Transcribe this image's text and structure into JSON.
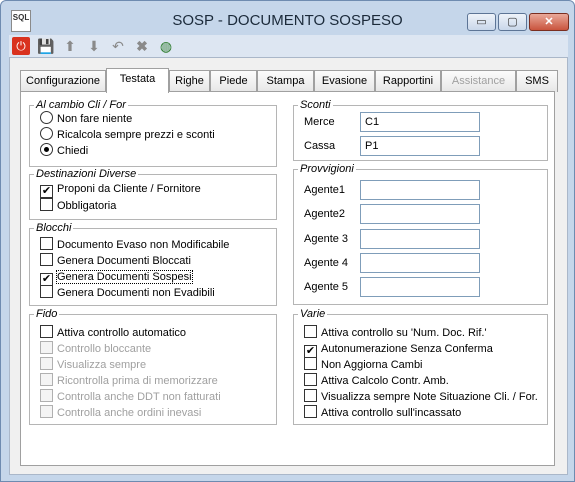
{
  "window": {
    "title": "SOSP - DOCUMENTO SOSPESO",
    "app_icon_text": "SQL",
    "minimize_symbol": "▭",
    "maximize_symbol": "▢",
    "close_symbol": "✕"
  },
  "toolbar": {
    "power_glyph": "⏻",
    "save_glyph": "💾",
    "up_glyph": "⬆",
    "down_glyph": "⬇",
    "undo_glyph": "↶",
    "delete_glyph": "✖",
    "globe_glyph": "◍"
  },
  "tabs": [
    {
      "label": "Configurazione"
    },
    {
      "label": "Testata"
    },
    {
      "label": "Righe"
    },
    {
      "label": "Piede"
    },
    {
      "label": "Stampa"
    },
    {
      "label": "Evasione"
    },
    {
      "label": "Rapportini"
    },
    {
      "label": "Assistance"
    },
    {
      "label": "SMS"
    }
  ],
  "cambio": {
    "title": "Al cambio Cli / For",
    "options": [
      "Non fare niente",
      "Ricalcola sempre prezzi e sconti",
      "Chiedi"
    ],
    "selected": "Chiedi"
  },
  "destinazioni": {
    "title": "Destinazioni Diverse",
    "items": [
      {
        "label": "Proponi da Cliente / Fornitore",
        "checked": true
      },
      {
        "label": "Obbligatoria",
        "checked": false
      }
    ]
  },
  "blocchi": {
    "title": "Blocchi",
    "items": [
      {
        "label": "Documento Evaso non Modificabile",
        "checked": false
      },
      {
        "label": "Genera Documenti Bloccati",
        "checked": false
      },
      {
        "label": "Genera Documenti Sospesi",
        "checked": true
      },
      {
        "label": "Genera Documenti non Evadibili",
        "checked": false
      }
    ]
  },
  "fido": {
    "title": "Fido",
    "items": [
      {
        "label": "Attiva controllo automatico",
        "checked": false,
        "enabled": true
      },
      {
        "label": "Controllo bloccante",
        "checked": false,
        "enabled": false
      },
      {
        "label": "Visualizza sempre",
        "checked": false,
        "enabled": false
      },
      {
        "label": "Ricontrolla prima di memorizzare",
        "checked": false,
        "enabled": false
      },
      {
        "label": "Controlla anche DDT non fatturati",
        "checked": false,
        "enabled": false
      },
      {
        "label": "Controlla anche ordini inevasi",
        "checked": false,
        "enabled": false
      }
    ]
  },
  "sconti": {
    "title": "Sconti",
    "fields": [
      {
        "label": "Merce",
        "value": "C1"
      },
      {
        "label": "Cassa",
        "value": "P1"
      }
    ]
  },
  "provvigioni": {
    "title": "Provvigioni",
    "fields": [
      {
        "label": "Agente1",
        "value": ""
      },
      {
        "label": "Agente2",
        "value": ""
      },
      {
        "label": "Agente 3",
        "value": ""
      },
      {
        "label": "Agente 4",
        "value": ""
      },
      {
        "label": "Agente 5",
        "value": ""
      }
    ]
  },
  "varie": {
    "title": "Varie",
    "items": [
      {
        "label": "Attiva controllo su 'Num. Doc. Rif.'",
        "checked": false
      },
      {
        "label": "Autonumerazione Senza Conferma",
        "checked": true
      },
      {
        "label": "Non Aggiorna Cambi",
        "checked": false
      },
      {
        "label": "Attiva Calcolo Contr. Amb.",
        "checked": false
      },
      {
        "label": "Visualizza sempre Note Situazione Cli. / For.",
        "checked": false
      },
      {
        "label": "Attiva controllo sull'incassato",
        "checked": false
      }
    ]
  },
  "check_mark": "✔"
}
